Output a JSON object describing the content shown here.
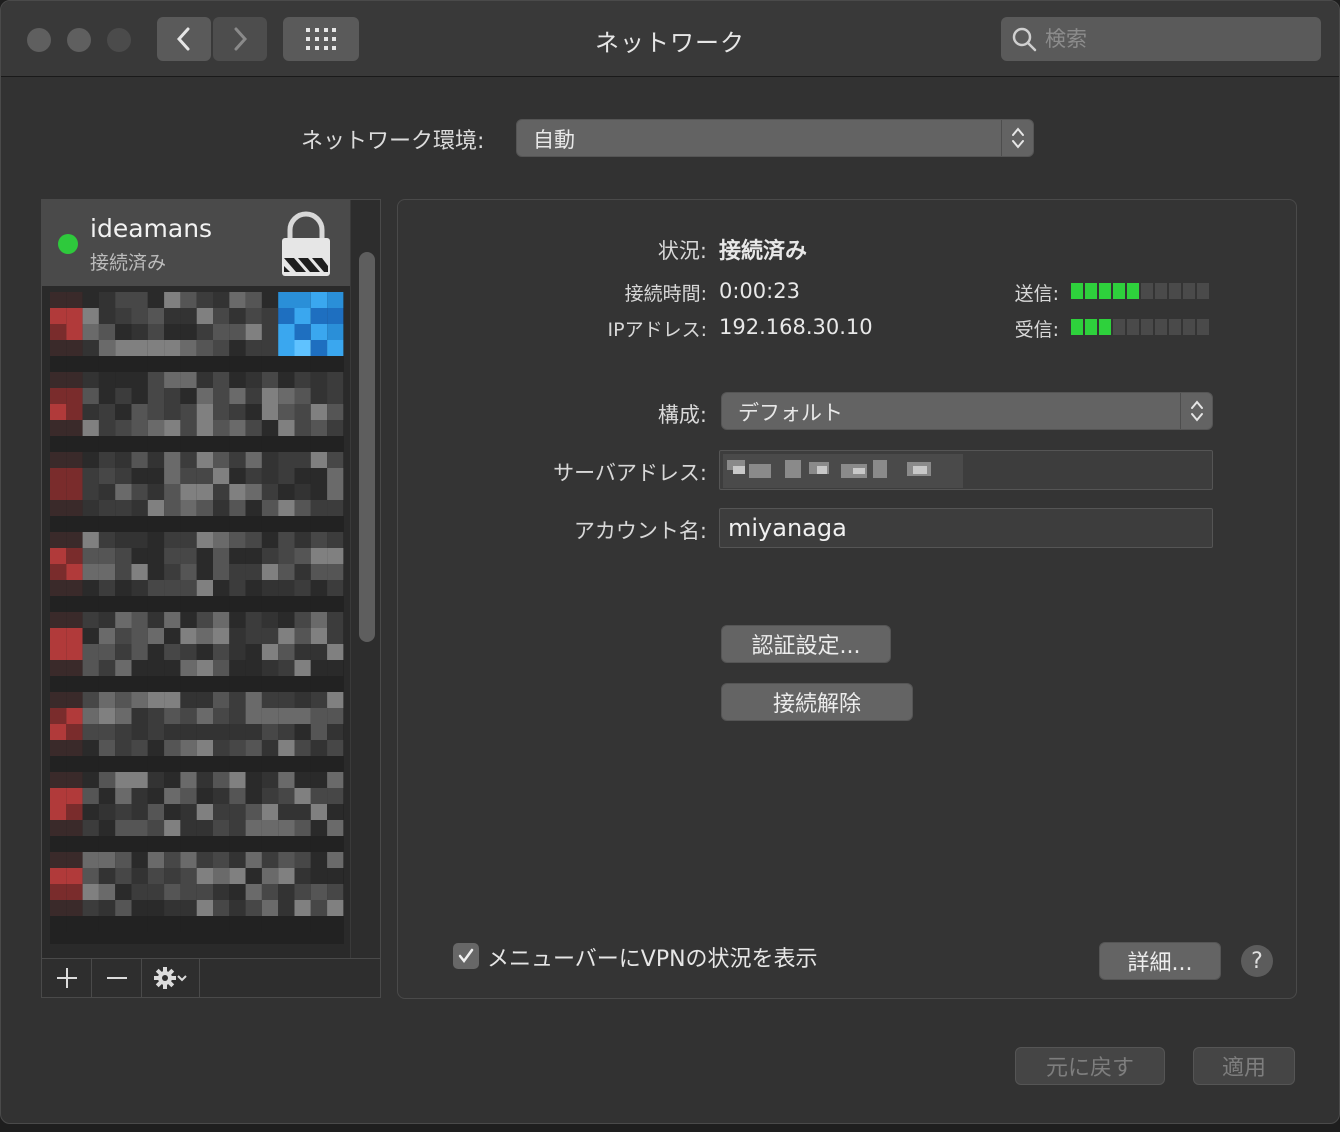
{
  "window": {
    "title": "ネットワーク"
  },
  "toolbar": {
    "search_placeholder": "検索"
  },
  "location": {
    "label": "ネットワーク環境:",
    "value": "自動"
  },
  "sidebar": {
    "selected": {
      "name": "ideamans",
      "status": "接続済み",
      "status_color": "#2ec93c"
    }
  },
  "detail": {
    "status_label": "状況:",
    "status_value": "接続済み",
    "connect_time_label": "接続時間:",
    "connect_time_value": "0:00:23",
    "ip_label": "IPアドレス:",
    "ip_value": "192.168.30.10",
    "send_label": "送信:",
    "receive_label": "受信:",
    "send_level": 0.5,
    "receive_level": 0.3,
    "config_label": "構成:",
    "config_value": "デフォルト",
    "server_label": "サーバアドレス:",
    "server_value": "",
    "account_label": "アカウント名:",
    "account_value": "miyanaga",
    "auth_button": "認証設定...",
    "disconnect_button": "接続解除",
    "show_vpn_label": "メニューバーにVPNの状況を表示",
    "show_vpn_checked": true,
    "advanced_button": "詳細...",
    "help_label": "?"
  },
  "footer": {
    "revert_button": "元に戻す",
    "apply_button": "適用"
  },
  "colors": {
    "meter_on": "#2ed13c",
    "accent": "#2ec93c"
  }
}
